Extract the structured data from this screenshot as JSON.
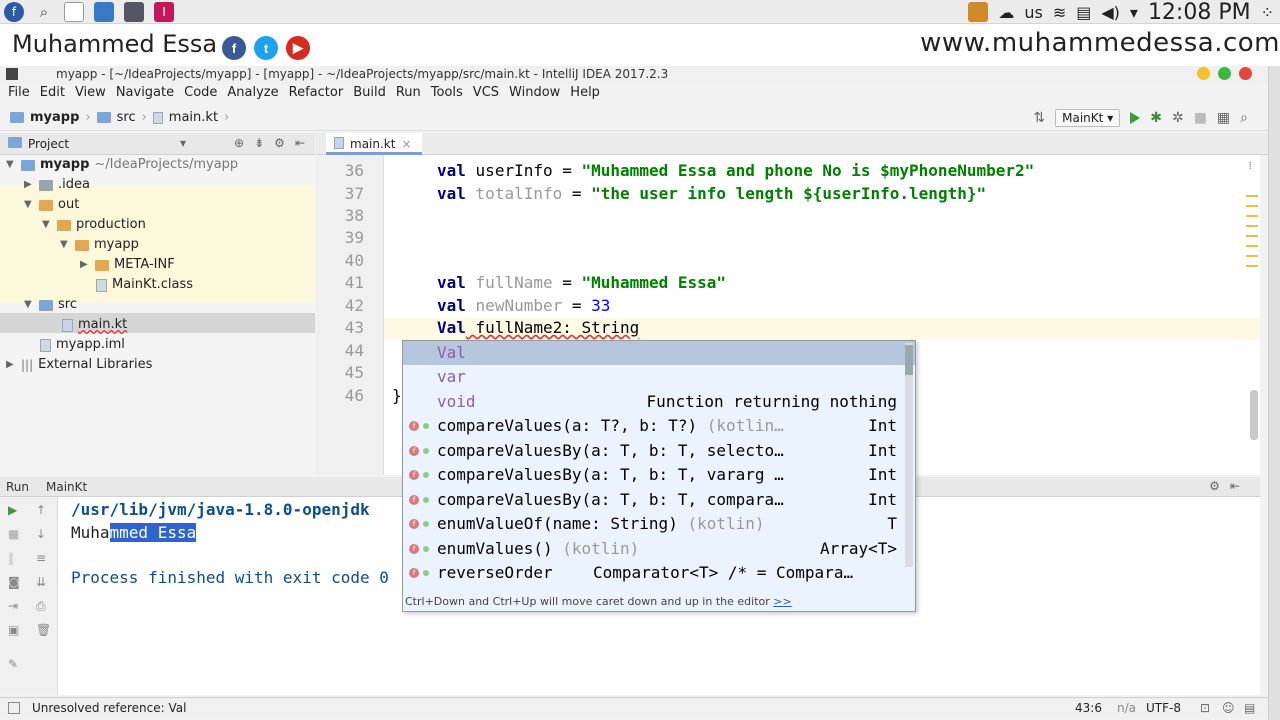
{
  "system": {
    "keyboard": "us",
    "clock": "12:08 PM"
  },
  "banner": {
    "name": "Muhammed Essa",
    "website": "www.muhammedessa.com",
    "social": [
      {
        "icon": "facebook-icon",
        "glyph": "f",
        "color": "#3b5998"
      },
      {
        "icon": "twitter-icon",
        "glyph": "t",
        "color": "#1da1f2"
      },
      {
        "icon": "youtube-icon",
        "glyph": "▶",
        "color": "#d62b1f"
      }
    ]
  },
  "window": {
    "title": "myapp - [~/IdeaProjects/myapp] - [myapp] - ~/IdeaProjects/myapp/src/main.kt - IntelliJ IDEA 2017.2.3"
  },
  "menu": [
    "File",
    "Edit",
    "View",
    "Navigate",
    "Code",
    "Analyze",
    "Refactor",
    "Build",
    "Run",
    "Tools",
    "VCS",
    "Window",
    "Help"
  ],
  "breadcrumbs": [
    "myapp",
    "src",
    "main.kt"
  ],
  "run_config": "MainKt",
  "project_panel": {
    "title": "Project",
    "tree": [
      {
        "label": "myapp",
        "sub": "~/IdeaProjects/myapp"
      },
      {
        "label": ".idea"
      },
      {
        "label": "out"
      },
      {
        "label": "production"
      },
      {
        "label": "myapp"
      },
      {
        "label": "META-INF"
      },
      {
        "label": "MainKt.class"
      },
      {
        "label": "src"
      },
      {
        "label": "main.kt"
      },
      {
        "label": "myapp.iml"
      },
      {
        "label": "External Libraries"
      }
    ]
  },
  "editor": {
    "tab": "main.kt",
    "line_numbers": [
      "36",
      "37",
      "38",
      "39",
      "40",
      "41",
      "42",
      "43",
      "44",
      "45",
      "46"
    ],
    "lines": {
      "l36": {
        "kw": "val",
        "name": "userInfo",
        "op": " = ",
        "str": "\"Muhammed Essa and phone No is $myPhoneNumber2\""
      },
      "l37": {
        "kw": "val",
        "name": "totalInfo",
        "op": " = ",
        "str": "\"the user info length ${userInfo.length}\""
      },
      "l41": {
        "kw": "val",
        "name": "fullName",
        "op": " = ",
        "str": "\"Muhammed Essa\""
      },
      "l42": {
        "kw": "val",
        "name": "newNumber",
        "op": " = ",
        "num": "33"
      },
      "l43": {
        "kw": "Val",
        "rest": " fullName2: String"
      },
      "l46": "}"
    }
  },
  "completion": {
    "items": [
      {
        "name": "Val",
        "type": ""
      },
      {
        "name": "var",
        "type": ""
      },
      {
        "name": "void",
        "type": "Function returning nothing"
      },
      {
        "name": "compareValues(a: T?, b: T?)",
        "grey": "(kotlin…",
        "type": "Int"
      },
      {
        "name": "compareValuesBy(a: T, b: T, selecto…",
        "type": "Int"
      },
      {
        "name": "compareValuesBy(a: T, b: T, vararg …",
        "type": "Int"
      },
      {
        "name": "compareValuesBy(a: T, b: T, compara…",
        "type": "Int"
      },
      {
        "name": "enumValueOf(name: String)",
        "grey": "(kotlin)",
        "type": "T"
      },
      {
        "name": "enumValues()",
        "grey": "(kotlin)",
        "type": "Array<T>"
      },
      {
        "name": "reverseOrder",
        "type": "Comparator<T> /* = Compara…"
      }
    ],
    "footer": "Ctrl+Down and Ctrl+Up will move caret down and up in the editor",
    "footer_link": ">>"
  },
  "run_panel": {
    "label": "Run",
    "config": "MainKt",
    "line1": "/usr/lib/jvm/java-1.8.0-openjdk",
    "line2_plain": "Muha",
    "line2_sel": "mmed Essa",
    "line3": "Process finished with exit code 0"
  },
  "status": {
    "message": "Unresolved reference: Val",
    "position": "43:6",
    "na": "n/a",
    "encoding": "UTF-8"
  }
}
